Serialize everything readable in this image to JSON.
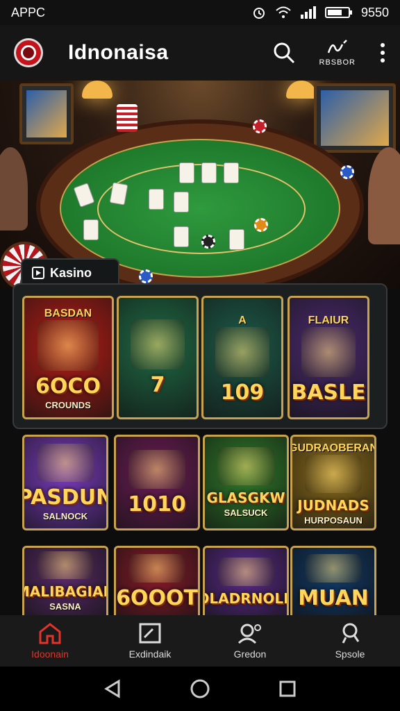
{
  "status": {
    "left": "APPC",
    "time": "9550"
  },
  "app": {
    "title": "Idnonaisa",
    "brand_label": "RBSBOR"
  },
  "section": {
    "tab_label": "Kasino"
  },
  "featured": [
    {
      "title": "6OCO",
      "subtitle": "CROUNDS",
      "top": "BASDAN",
      "bg": "#b51d16"
    },
    {
      "title": "7",
      "subtitle": "",
      "top": "",
      "bg": "#1f6a45"
    },
    {
      "title": "109",
      "subtitle": "",
      "top": "A",
      "bg": "#1d5a48"
    },
    {
      "title": "BASLE",
      "subtitle": "",
      "top": "FLAIUR",
      "bg": "#4a2a6e"
    }
  ],
  "games_row2": [
    {
      "title": "PASDUN",
      "subtitle": "SALNOCK",
      "bg": "#7a3bbd"
    },
    {
      "title": "1010",
      "subtitle": "",
      "bg": "#6d1c55"
    },
    {
      "title": "GLASGKW",
      "subtitle": "SALSUCK",
      "bg": "#2f7a2a"
    },
    {
      "title": "JUDNADS",
      "subtitle": "HURPOSAUN",
      "top": "GUDRAOBERAN",
      "bg": "#8a6a1a"
    }
  ],
  "games_row3": [
    {
      "title": "MALIBAGIAN",
      "subtitle": "SASNA",
      "bg": "#5a2a6a"
    },
    {
      "title": "6OOOT",
      "subtitle": "",
      "bg": "#8a1a2a"
    },
    {
      "title": "OLADRNOLK",
      "subtitle": "",
      "bg": "#5a2a8a"
    },
    {
      "title": "MUAN",
      "subtitle": "",
      "bg": "#0f3a6a"
    }
  ],
  "nav": [
    {
      "label": "Idoonain",
      "icon": "home-icon",
      "active": true
    },
    {
      "label": "Exdindaik",
      "icon": "checkbox-icon",
      "active": false
    },
    {
      "label": "Gredon",
      "icon": "user-search-icon",
      "active": false
    },
    {
      "label": "Spsole",
      "icon": "search-user-icon",
      "active": false
    }
  ],
  "colors": {
    "accent": "#e2342b",
    "gold": "#c8a24c",
    "felt": "#1f7a2c"
  }
}
